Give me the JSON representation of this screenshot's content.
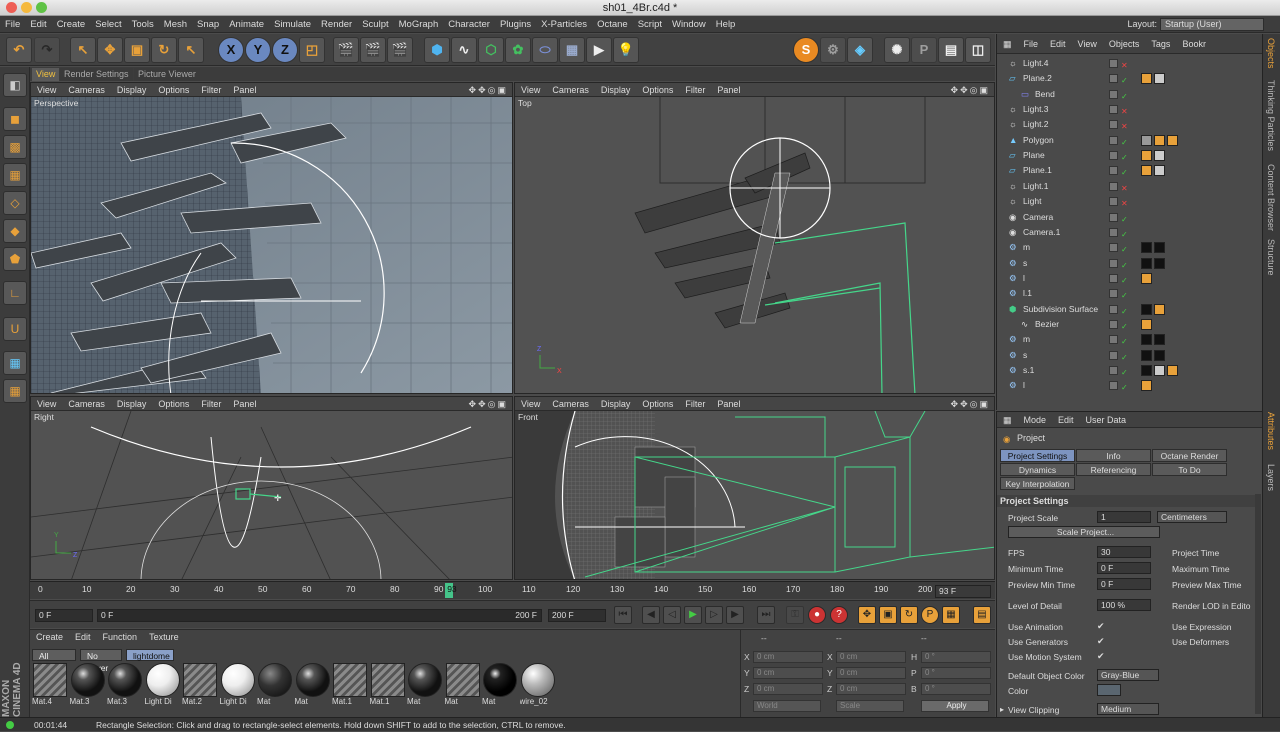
{
  "window": {
    "title": "sh01_4Br.c4d *"
  },
  "menubar": [
    "File",
    "Edit",
    "Create",
    "Select",
    "Tools",
    "Mesh",
    "Snap",
    "Animate",
    "Simulate",
    "Render",
    "Sculpt",
    "MoGraph",
    "Character",
    "Plugins",
    "X-Particles",
    "Octane",
    "Script",
    "Window",
    "Help"
  ],
  "layout": {
    "label": "Layout:",
    "value": "Startup (User)"
  },
  "toolbar": {
    "axis_x": "X",
    "axis_y": "Y",
    "axis_z": "Z"
  },
  "viewtabs": [
    "View",
    "Render Settings",
    "Picture Viewer"
  ],
  "viewport_menu": [
    "View",
    "Cameras",
    "Display",
    "Options",
    "Filter",
    "Panel"
  ],
  "viewports": {
    "perspective": "Perspective",
    "top": "Top",
    "right": "Right",
    "front": "Front"
  },
  "timeline": {
    "ticks": [
      "0",
      "10",
      "20",
      "30",
      "40",
      "50",
      "60",
      "70",
      "80",
      "90",
      "93",
      "100",
      "110",
      "120",
      "130",
      "140",
      "150",
      "160",
      "170",
      "180",
      "190",
      "200"
    ],
    "current": "93 F",
    "current_frame": 93,
    "max_frame": 200
  },
  "playback": {
    "start": "0 F",
    "range_start": "0 F",
    "range_end": "200 F",
    "end": "200 F"
  },
  "materials": {
    "menu": [
      "Create",
      "Edit",
      "Function",
      "Texture"
    ],
    "filters": [
      "All",
      "No Layer",
      "lightdome"
    ],
    "items": [
      {
        "name": "Mat.4",
        "type": "stripe"
      },
      {
        "name": "Mat.3",
        "type": "dark"
      },
      {
        "name": "Mat.3",
        "type": "dark"
      },
      {
        "name": "Light Di",
        "type": "white"
      },
      {
        "name": "Mat.2",
        "type": "stripe"
      },
      {
        "name": "Light Di",
        "type": "white"
      },
      {
        "name": "Mat",
        "type": "rough"
      },
      {
        "name": "Mat",
        "type": "dark"
      },
      {
        "name": "Mat.1",
        "type": "stripe"
      },
      {
        "name": "Mat.1",
        "type": "stripe"
      },
      {
        "name": "Mat",
        "type": "dark"
      },
      {
        "name": "Mat",
        "type": "stripe"
      },
      {
        "name": "Mat",
        "type": "black"
      },
      {
        "name": "wire_02",
        "type": "grey"
      }
    ]
  },
  "coords": {
    "headers": [
      "--",
      "--",
      "--"
    ],
    "rows": [
      {
        "a": "X",
        "v1": "0 cm",
        "b": "X",
        "v2": "0 cm",
        "c": "H",
        "v3": "0 °"
      },
      {
        "a": "Y",
        "v1": "0 cm",
        "b": "Y",
        "v2": "0 cm",
        "c": "P",
        "v3": "0 °"
      },
      {
        "a": "Z",
        "v1": "0 cm",
        "b": "Z",
        "v2": "0 cm",
        "c": "B",
        "v3": "0 °"
      }
    ],
    "world": "World",
    "scale": "Scale",
    "apply": "Apply"
  },
  "status": {
    "time": "00:01:44",
    "message": "Rectangle Selection: Click and drag to rectangle-select elements. Hold down SHIFT to add to the selection, CTRL to remove."
  },
  "objects": {
    "menu": [
      "File",
      "Edit",
      "View",
      "Objects",
      "Tags",
      "Bookr"
    ],
    "items": [
      {
        "name": "Light.4",
        "indent": 0,
        "icon": "light"
      },
      {
        "name": "Plane.2",
        "indent": 0,
        "icon": "plane"
      },
      {
        "name": "Bend",
        "indent": 1,
        "icon": "deformer"
      },
      {
        "name": "Light.3",
        "indent": 0,
        "icon": "light"
      },
      {
        "name": "Light.2",
        "indent": 0,
        "icon": "light"
      },
      {
        "name": "Polygon",
        "indent": 0,
        "icon": "polygon"
      },
      {
        "name": "Plane",
        "indent": 0,
        "icon": "plane"
      },
      {
        "name": "Plane.1",
        "indent": 0,
        "icon": "plane"
      },
      {
        "name": "Light.1",
        "indent": 0,
        "icon": "light"
      },
      {
        "name": "Light",
        "indent": 0,
        "icon": "light"
      },
      {
        "name": "Camera",
        "indent": 0,
        "icon": "camera"
      },
      {
        "name": "Camera.1",
        "indent": 0,
        "icon": "camera"
      },
      {
        "name": "m",
        "indent": 0,
        "icon": "null"
      },
      {
        "name": "s",
        "indent": 0,
        "icon": "null"
      },
      {
        "name": "l",
        "indent": 0,
        "icon": "null"
      },
      {
        "name": "l.1",
        "indent": 0,
        "icon": "null"
      },
      {
        "name": "Subdivision Surface",
        "indent": 0,
        "icon": "subdiv"
      },
      {
        "name": "Bezier",
        "indent": 1,
        "icon": "spline"
      },
      {
        "name": "m",
        "indent": 0,
        "icon": "null"
      },
      {
        "name": "s",
        "indent": 0,
        "icon": "null"
      },
      {
        "name": "s.1",
        "indent": 0,
        "icon": "null"
      },
      {
        "name": "l",
        "indent": 0,
        "icon": "null"
      }
    ]
  },
  "sidetabs": [
    "Objects",
    "Thinking Particles",
    "Content Browser",
    "Structure",
    "Attributes",
    "Layers"
  ],
  "attributes": {
    "menu": [
      "Mode",
      "Edit",
      "User Data"
    ],
    "object": "Project",
    "tabs": [
      "Project Settings",
      "Info",
      "Octane Render",
      "Dynamics",
      "Referencing",
      "To Do",
      "Key Interpolation"
    ],
    "section": "Project Settings",
    "project_scale_label": "Project Scale",
    "project_scale": "1",
    "units": "Centimeters",
    "scale_project": "Scale Project...",
    "fps_label": "FPS",
    "fps": "30",
    "min_time_label": "Minimum Time",
    "min_time": "0 F",
    "preview_min_label": "Preview Min Time",
    "preview_min": "0 F",
    "project_time_label": "Project Time",
    "max_time_label": "Maximum Time",
    "preview_max_label": "Preview Max Time",
    "lod_label": "Level of Detail",
    "lod": "100 %",
    "render_lod_label": "Render LOD in Edito",
    "use_animation": "Use Animation",
    "use_expression": "Use Expression",
    "use_generators": "Use Generators",
    "use_deformers": "Use Deformers",
    "use_motion": "Use Motion System",
    "default_color_label": "Default Object Color",
    "default_color": "Gray-Blue",
    "color_label": "Color",
    "view_clipping_label": "View Clipping",
    "view_clipping": "Medium"
  },
  "brand": {
    "line1": "MAXON",
    "line2": "CINEMA 4D"
  }
}
